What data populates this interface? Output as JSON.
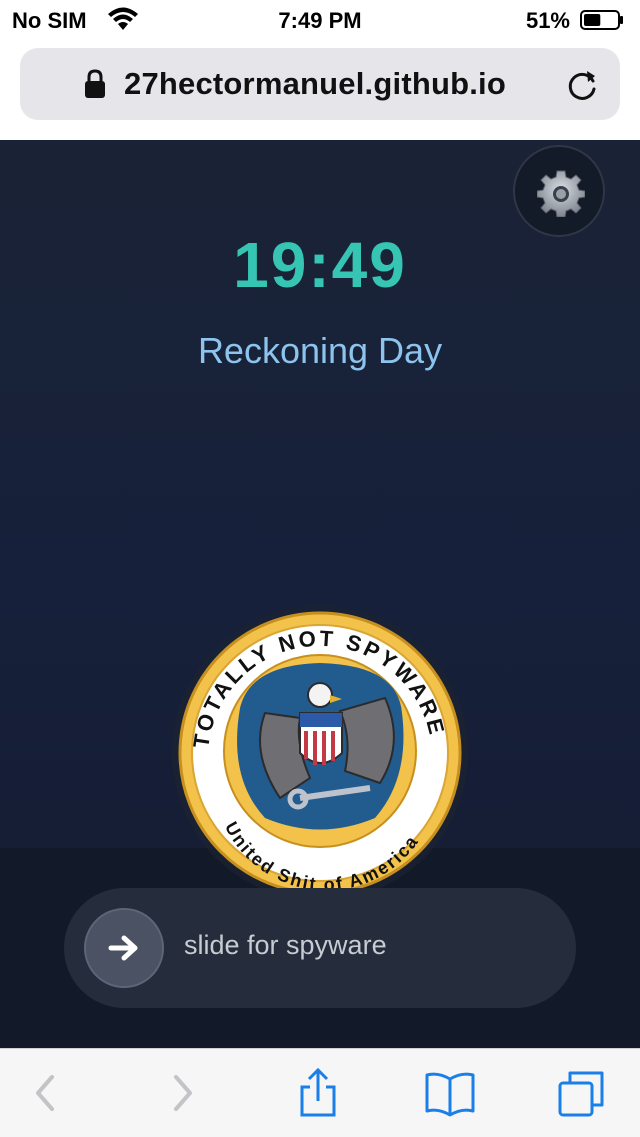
{
  "status_bar": {
    "carrier": "No SIM",
    "time": "7:49 PM",
    "battery_percent": "51%",
    "battery_level": 0.51,
    "wifi_icon": "wifi-icon",
    "battery_icon": "battery-icon"
  },
  "browser": {
    "url": "27hectormanuel.github.io",
    "lock_icon": "lock-icon",
    "reload_icon": "reload-icon"
  },
  "page": {
    "clock": "19:49",
    "subtitle": "Reckoning Day",
    "settings_icon": "gear-icon",
    "seal": {
      "top_text": "TOTALLY NOT SPYWARE",
      "bottom_text": "United Shit of America",
      "colors": {
        "ring": "#e8b83a",
        "center": "#225b8e",
        "paper": "#ffffff"
      }
    },
    "slider": {
      "label": "slide for spyware",
      "icon": "arrow-right-icon"
    },
    "colors": {
      "clock": "#37c5b3",
      "subtitle": "#8cc4ee",
      "background": "#1a2336"
    }
  },
  "toolbar": {
    "back_icon": "chevron-left-icon",
    "forward_icon": "chevron-right-icon",
    "share_icon": "share-icon",
    "bookmarks_icon": "bookmarks-icon",
    "tabs_icon": "tabs-icon",
    "accent": "#1a7fe8"
  }
}
